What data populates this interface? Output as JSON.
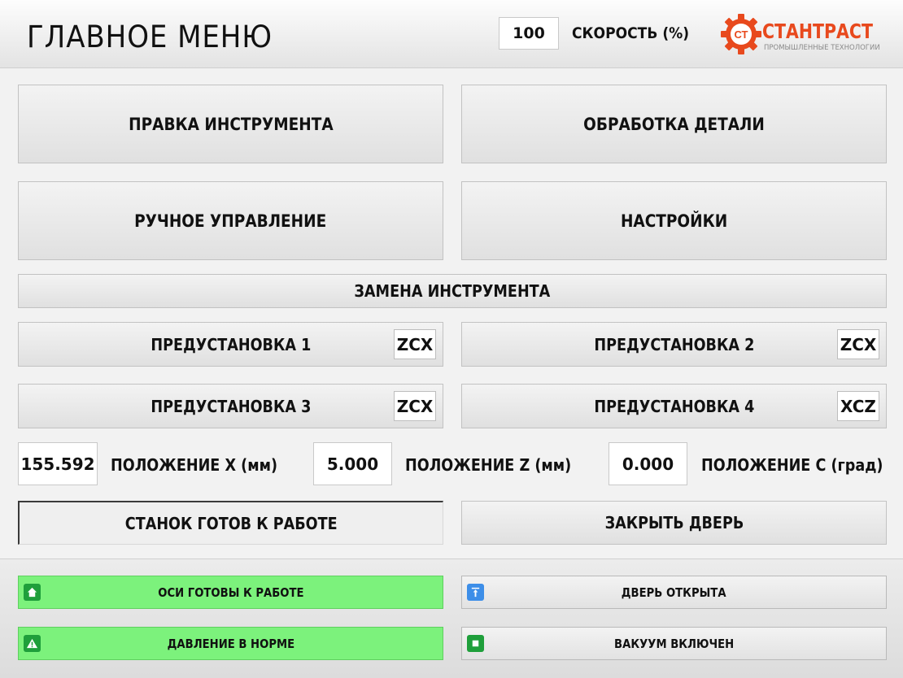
{
  "header": {
    "title": "ГЛАВНОЕ МЕНЮ",
    "speed_value": "100",
    "speed_label": "СКОРОСТЬ (%)",
    "logo": {
      "name": "СТАНТРАСТ",
      "subtitle": "ПРОМЫШЛЕННЫЕ ТЕХНОЛОГИИ",
      "mark": "СТ",
      "color": "#e8491d"
    }
  },
  "menu": {
    "tool_dressing": "ПРАВКА ИНСТРУМЕНТА",
    "part_processing": "ОБРАБОТКА ДЕТАЛИ",
    "manual_control": "РУЧНОЕ УПРАВЛЕНИЕ",
    "settings": "НАСТРОЙКИ",
    "tool_change": "ЗАМЕНА ИНСТРУМЕНТА"
  },
  "presets": [
    {
      "label": "ПРЕДУСТАНОВКА 1",
      "order": "ZCX"
    },
    {
      "label": "ПРЕДУСТАНОВКА 2",
      "order": "ZCX"
    },
    {
      "label": "ПРЕДУСТАНОВКА 3",
      "order": "ZCX"
    },
    {
      "label": "ПРЕДУСТАНОВКА 4",
      "order": "XCZ"
    }
  ],
  "positions": [
    {
      "value": "155.592",
      "label": "ПОЛОЖЕНИЕ X (мм)"
    },
    {
      "value": "5.000",
      "label": "ПОЛОЖЕНИЕ Z (мм)"
    },
    {
      "value": "0.000",
      "label": "ПОЛОЖЕНИЕ C (град)"
    }
  ],
  "actions": {
    "machine_ready": "СТАНОК ГОТОВ К РАБОТЕ",
    "close_door": "ЗАКРЫТЬ ДВЕРЬ"
  },
  "indicators": [
    {
      "label": "ОСИ ГОТОВЫ К РАБОТЕ",
      "state": "on",
      "icon": "home-icon",
      "color": "#7cf27c"
    },
    {
      "label": "ДВЕРЬ ОТКРЫТА",
      "state": "off",
      "icon": "door-open-icon",
      "color": "#3d8ee8"
    },
    {
      "label": "ДАВЛЕНИЕ В НОРМЕ",
      "state": "on",
      "icon": "warning-icon",
      "color": "#7cf27c"
    },
    {
      "label": "ВАКУУМ ВКЛЮЧЕН",
      "state": "off",
      "icon": "square-icon",
      "color": "#1f9f3b"
    }
  ]
}
